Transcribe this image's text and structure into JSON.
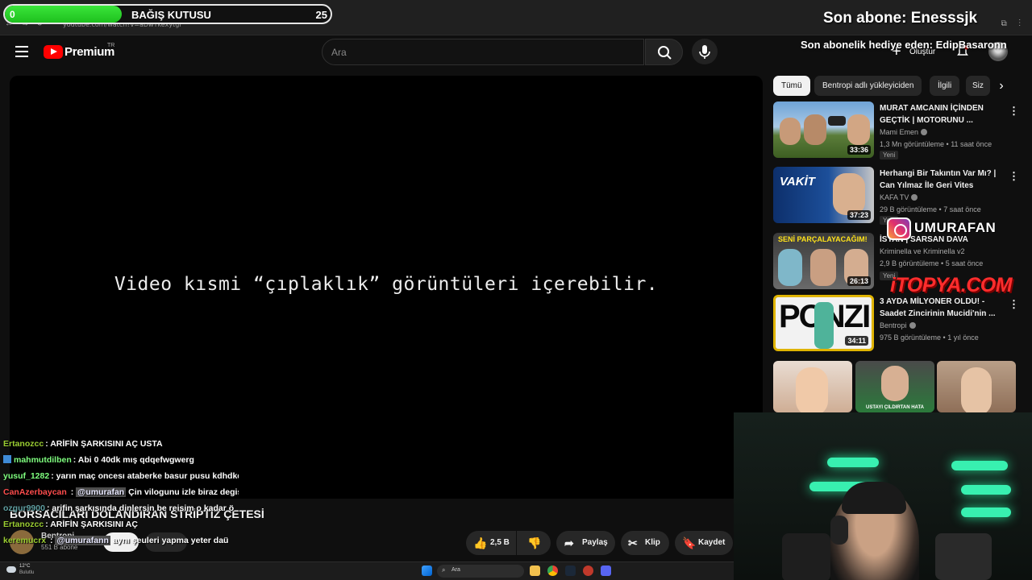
{
  "browser": {
    "url": "youtube.com/watch?v=aDwYkexytgl"
  },
  "donation": {
    "start": "0",
    "title": "BAĞIŞ KUTUSU",
    "goal": "25",
    "progress_fraction": 0.36,
    "fill_color": "#2ed62e"
  },
  "overlay": {
    "last_sub": "Son abone: Enesssjk",
    "last_gift": "Son abonelik hediye eden: EdipBasaronn",
    "instagram": "UMURAFAN",
    "sponsor": "iTOPYA.COM"
  },
  "header": {
    "brand": "Premium",
    "region": "TR",
    "search_placeholder": "Ara",
    "create_label": "Oluştur"
  },
  "player": {
    "notice": "Video kısmi “çıplaklık” görüntüleri içerebilir."
  },
  "chips": [
    "Tümü",
    "Bentropi adlı yükleyiciden",
    "İlgili",
    "Siz"
  ],
  "recommendations": [
    {
      "title": "MURAT AMCANIN İÇİNDEN GEÇTİK | MOTORUNU ...",
      "channel": "Mami Emen",
      "meta": "1,3 Mn görüntüleme • 11 saat önce",
      "badge": "Yeni",
      "duration": "33:36"
    },
    {
      "title": "Herhangi Bir Takıntın Var Mı? | Can Yılmaz İle Geri Vites",
      "channel": "KAFA TV",
      "meta": "29 B görüntüleme • 7 saat önce",
      "badge": "Yeni",
      "duration": "37:23"
    },
    {
      "title": "İSYAN | SARSAN DAVA",
      "channel": "Kriminella ve Kriminella v2",
      "meta": "2,9 B görüntüleme • 5 saat önce",
      "badge": "Yeni",
      "duration": "26:13"
    },
    {
      "title": "3 AYDA MİLYONER OLDU! - Saadet Zincirinin Mucidi'nin ...",
      "channel": "Bentropi",
      "meta": "975 B görüntüleme • 1 yıl önce",
      "badge": "",
      "duration": "34:11"
    }
  ],
  "thumb_texts": {
    "rec2": "VAKİT",
    "rec3": "SENİ PARÇALAYACAĞIM!",
    "rec4": "PONZI",
    "short2": "USTAYI ÇILDIRTAN HATA"
  },
  "chat": [
    {
      "user": "Ertanozcc",
      "color": "#9acd32",
      "text": ": ARİFİN ŞARKISINI AÇ USTA"
    },
    {
      "user": "mahmutdilben",
      "color": "#7fff7f",
      "text": ": Abi 0 40dk mış qdqefwgwerg"
    },
    {
      "user": "yusuf_1282",
      "color": "#7fff7f",
      "text": ": yarın maç oncesı ataberke basur pusu kdhdkd"
    },
    {
      "user": "CanAzerbaycan",
      "color": "#ff4d4d",
      "mention": "@umurafan",
      "text": " Çin vilogunu izle biraz degisil"
    },
    {
      "user": "ozgur9900",
      "color": "#5f9ea0",
      "text": ": arifin şarkısında dinlersin be reisim o kadar ö"
    },
    {
      "user": "Ertanozcc",
      "color": "#9acd32",
      "text": ": ARİFİN ŞARKISINI AÇ"
    },
    {
      "user": "keremucrx",
      "color": "#9acd32",
      "mention": "@umurafann",
      "text": " aynı şeuleri yapma yeter daü"
    }
  ],
  "video": {
    "title": "BORSACILARI DOLANDIRAN STRİPTİZ ÇETESİ",
    "channel": "Bentropi",
    "subscribers": "551 B abone",
    "likes": "2,5 B",
    "share": "Paylaş",
    "clip": "Klip",
    "save": "Kaydet"
  },
  "taskbar": {
    "temp": "12°C",
    "weather": "Bulutlu",
    "search": "Ara"
  }
}
